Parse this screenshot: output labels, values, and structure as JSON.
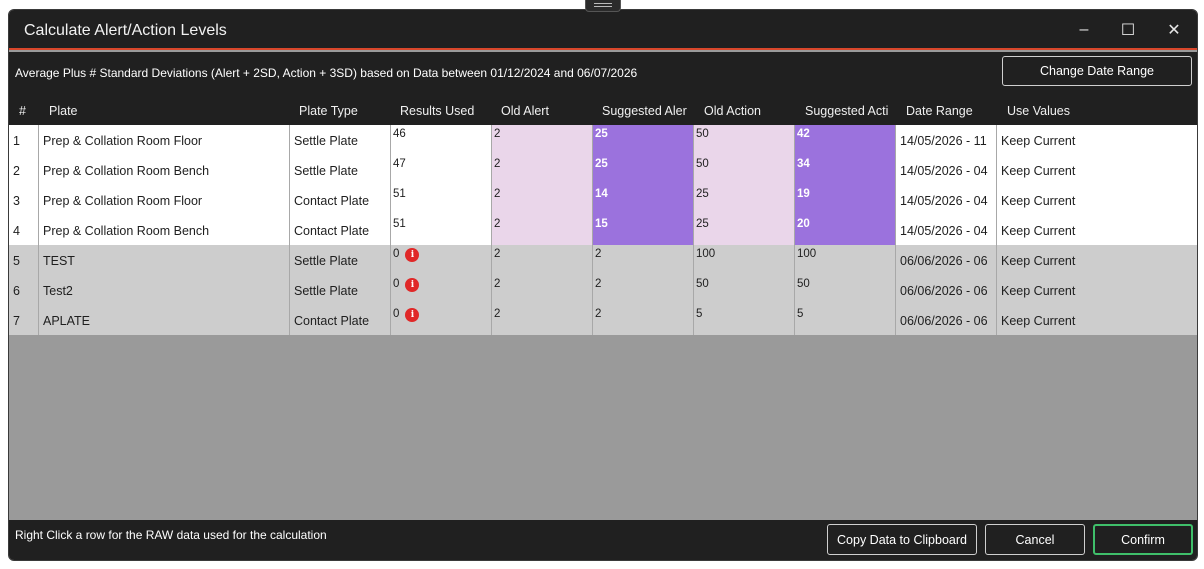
{
  "window": {
    "title": "Calculate Alert/Action Levels",
    "minimize_icon": "–",
    "maximize_icon": "☐",
    "close_icon": "✕"
  },
  "header": {
    "description": "Average Plus # Standard Deviations (Alert + 2SD, Action + 3SD) based on Data between 01/12/2024 and 06/07/2026",
    "change_date_range_label": "Change Date Range"
  },
  "columns": [
    "#",
    "Plate",
    "Plate Type",
    "Results Used",
    "Old Alert",
    "Suggested Aler",
    "Old Action",
    "Suggested Acti",
    "Date Range",
    "Use Values"
  ],
  "rows": [
    {
      "num": "1",
      "plate": "Prep & Collation Room Floor",
      "plate_type": "Settle Plate",
      "results_used": "46",
      "old_alert": "2",
      "suggested_alert": "25",
      "old_action": "50",
      "suggested_action": "42",
      "date_range": "14/05/2026 - 11",
      "use_values": "Keep Current"
    },
    {
      "num": "2",
      "plate": "Prep & Collation Room Bench",
      "plate_type": "Settle Plate",
      "results_used": "47",
      "old_alert": "2",
      "suggested_alert": "25",
      "old_action": "50",
      "suggested_action": "34",
      "date_range": "14/05/2026 - 04",
      "use_values": "Keep Current"
    },
    {
      "num": "3",
      "plate": "Prep & Collation Room Floor",
      "plate_type": "Contact Plate",
      "results_used": "51",
      "old_alert": "2",
      "suggested_alert": "14",
      "old_action": "25",
      "suggested_action": "19",
      "date_range": "14/05/2026 - 04",
      "use_values": "Keep Current"
    },
    {
      "num": "4",
      "plate": "Prep & Collation Room Bench",
      "plate_type": "Contact Plate",
      "results_used": "51",
      "old_alert": "2",
      "suggested_alert": "15",
      "old_action": "25",
      "suggested_action": "20",
      "date_range": "14/05/2026 - 04",
      "use_values": "Keep Current"
    },
    {
      "num": "5",
      "plate": "TEST",
      "plate_type": "Settle Plate",
      "results_used": "0",
      "old_alert": "2",
      "suggested_alert": "2",
      "old_action": "100",
      "suggested_action": "100",
      "date_range": "06/06/2026 - 06",
      "use_values": "Keep Current"
    },
    {
      "num": "6",
      "plate": "Test2",
      "plate_type": "Settle Plate",
      "results_used": "0",
      "old_alert": "2",
      "suggested_alert": "2",
      "old_action": "50",
      "suggested_action": "50",
      "date_range": "06/06/2026 - 06",
      "use_values": "Keep Current"
    },
    {
      "num": "7",
      "plate": "APLATE",
      "plate_type": "Contact Plate",
      "results_used": "0",
      "old_alert": "2",
      "suggested_alert": "2",
      "old_action": "5",
      "suggested_action": "5",
      "date_range": "06/06/2026 - 06",
      "use_values": "Keep Current"
    }
  ],
  "info_icon_glyph": "i",
  "footer": {
    "hint": "Right Click a row for the RAW data used for the calculation",
    "copy_label": "Copy Data to Clipboard",
    "cancel_label": "Cancel",
    "confirm_label": "Confirm"
  },
  "colors": {
    "title_accent": "#d9472b",
    "suggested_highlight": "#9b72dd",
    "old_highlight": "#ead6ea",
    "confirm_border": "#3fbf6a",
    "info_icon": "#e02828"
  }
}
